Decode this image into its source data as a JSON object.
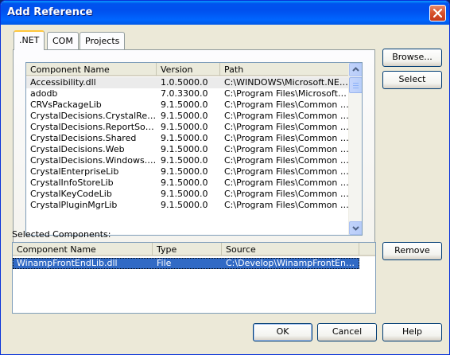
{
  "window": {
    "title": "Add Reference"
  },
  "tabs": [
    {
      "label": ".NET"
    },
    {
      "label": "COM"
    },
    {
      "label": "Projects"
    }
  ],
  "components": {
    "columns": [
      "Component Name",
      "Version",
      "Path"
    ],
    "rows": [
      {
        "name": "Accessibility.dll",
        "version": "1.0.5000.0",
        "path": "C:\\WINDOWS\\Microsoft.NET..."
      },
      {
        "name": "adodb",
        "version": "7.0.3300.0",
        "path": "C:\\Program Files\\Microsoft.N..."
      },
      {
        "name": "CRVsPackageLib",
        "version": "9.1.5000.0",
        "path": "C:\\Program Files\\Common Fil..."
      },
      {
        "name": "CrystalDecisions.CrystalRepo...",
        "version": "9.1.5000.0",
        "path": "C:\\Program Files\\Common Fil..."
      },
      {
        "name": "CrystalDecisions.ReportSource",
        "version": "9.1.5000.0",
        "path": "C:\\Program Files\\Common Fil..."
      },
      {
        "name": "CrystalDecisions.Shared",
        "version": "9.1.5000.0",
        "path": "C:\\Program Files\\Common Fil..."
      },
      {
        "name": "CrystalDecisions.Web",
        "version": "9.1.5000.0",
        "path": "C:\\Program Files\\Common Fil..."
      },
      {
        "name": "CrystalDecisions.Windows.Fo...",
        "version": "9.1.5000.0",
        "path": "C:\\Program Files\\Common Fil..."
      },
      {
        "name": "CrystalEnterpriseLib",
        "version": "9.1.5000.0",
        "path": "C:\\Program Files\\Common Fil..."
      },
      {
        "name": "CrystalInfoStoreLib",
        "version": "9.1.5000.0",
        "path": "C:\\Program Files\\Common Fil..."
      },
      {
        "name": "CrystalKeyCodeLib",
        "version": "9.1.5000.0",
        "path": "C:\\Program Files\\Common Fil..."
      },
      {
        "name": "CrystalPluginMgrLib",
        "version": "9.1.5000.0",
        "path": "C:\\Program Files\\Common Fil..."
      }
    ]
  },
  "side_buttons": {
    "browse": "Browse...",
    "select": "Select",
    "remove": "Remove"
  },
  "selected": {
    "label": "Selected Components:",
    "columns": [
      "Component Name",
      "Type",
      "Source"
    ],
    "rows": [
      {
        "name": "WinampFrontEndLib.dll",
        "type": "File",
        "source": "C:\\Develop\\WinampFrontEndSo..."
      }
    ]
  },
  "footer": {
    "ok": "OK",
    "cancel": "Cancel",
    "help": "Help"
  },
  "icons": {
    "close": "close-icon",
    "scroll_up": "arrow-up-icon",
    "scroll_down": "arrow-down-icon"
  },
  "colors": {
    "title_bar": "#0054e3",
    "selection": "#316ac5",
    "dialog_bg": "#ece9d8"
  }
}
